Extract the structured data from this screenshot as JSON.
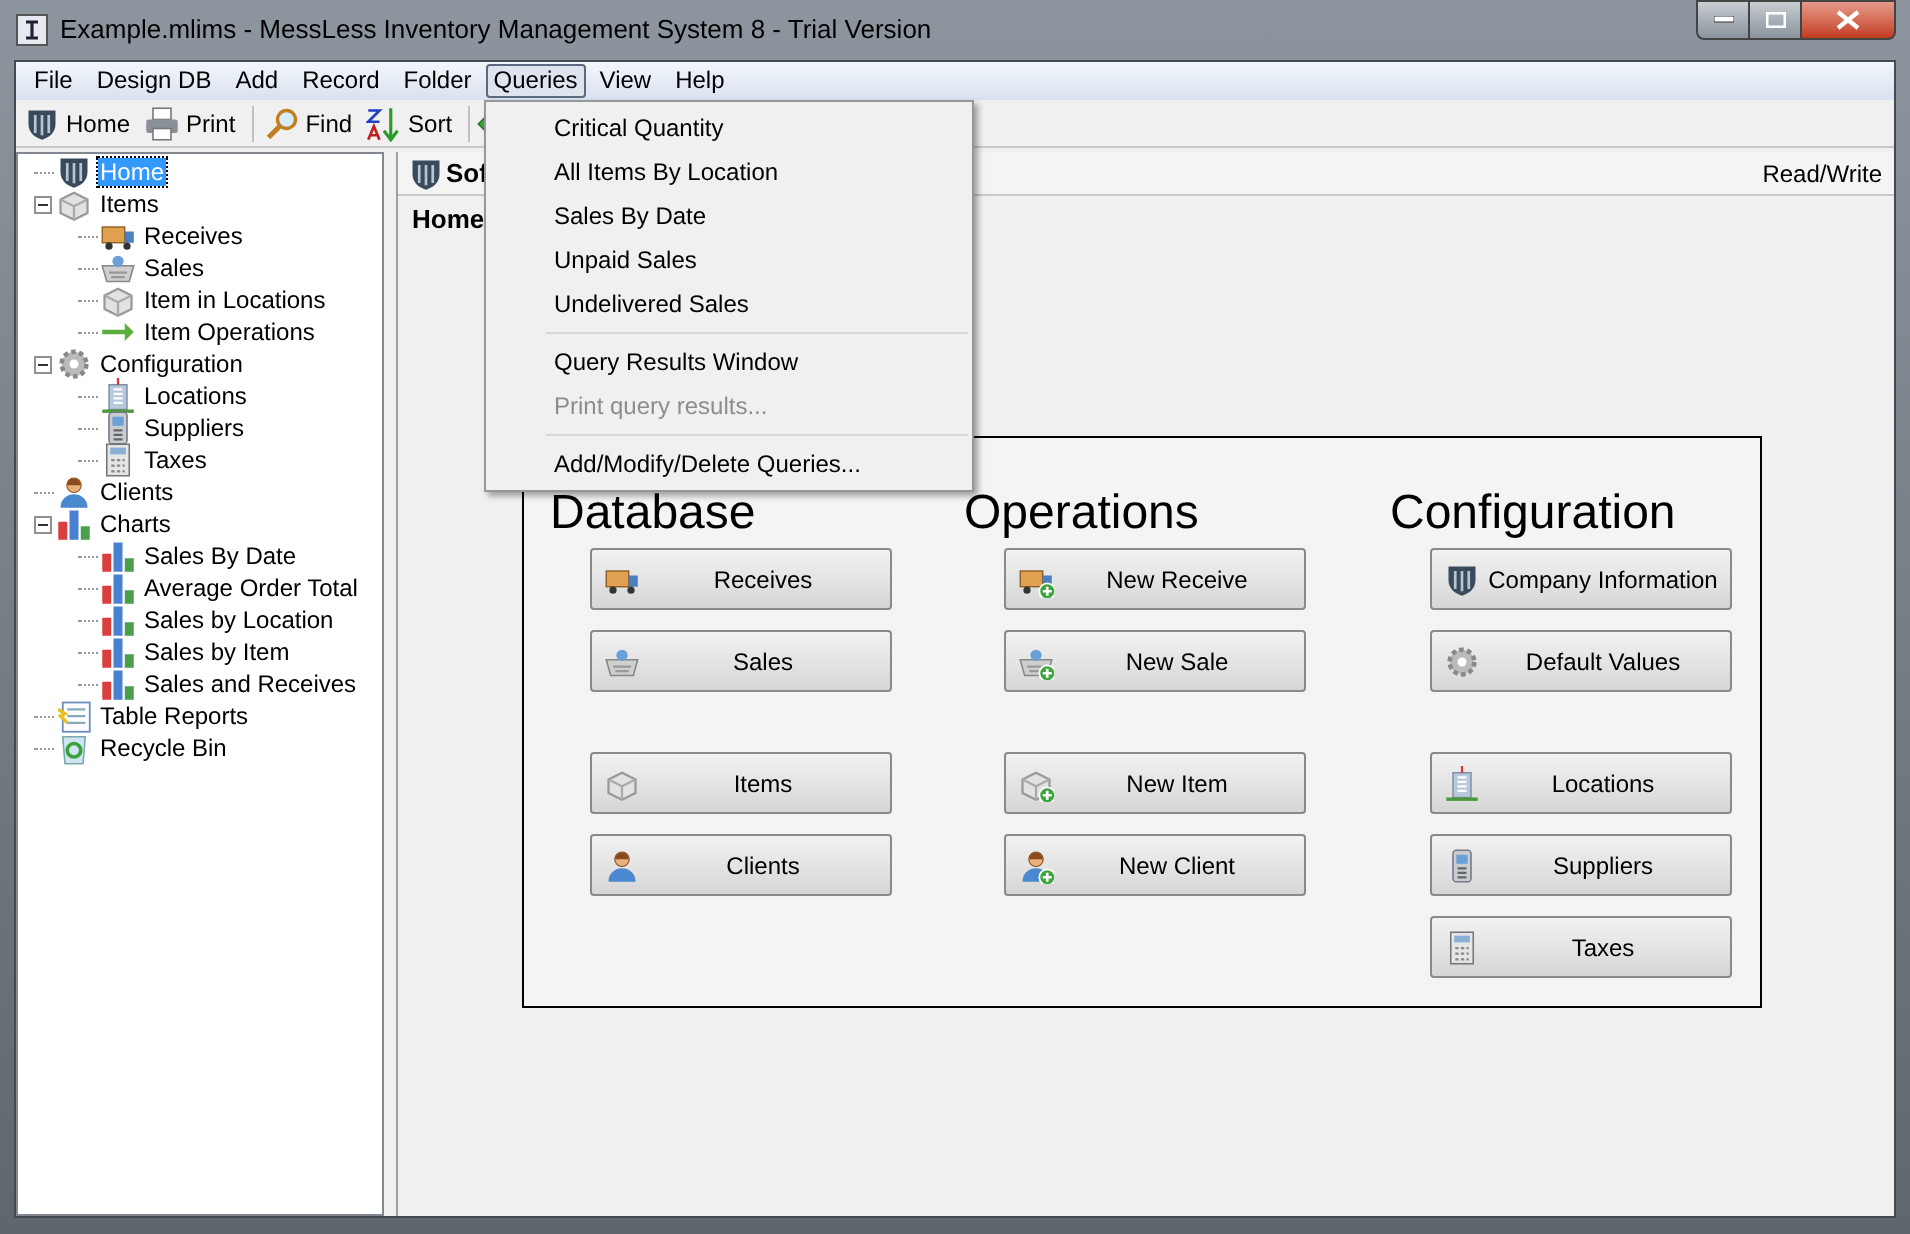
{
  "window": {
    "title": "Example.mlims - MessLess Inventory Management System 8 - Trial Version"
  },
  "menu_bar": [
    {
      "label": "File",
      "selected": false
    },
    {
      "label": "Design DB",
      "selected": false
    },
    {
      "label": "Add",
      "selected": false
    },
    {
      "label": "Record",
      "selected": false
    },
    {
      "label": "Folder",
      "selected": false
    },
    {
      "label": "Queries",
      "selected": true
    },
    {
      "label": "View",
      "selected": false
    },
    {
      "label": "Help",
      "selected": false
    }
  ],
  "toolbar": [
    {
      "label": "Home",
      "kind": "shield"
    },
    {
      "label": "Print",
      "kind": "printer"
    },
    {
      "label": "Find",
      "kind": "search"
    },
    {
      "label": "Sort",
      "kind": "sort"
    },
    {
      "kind": "back"
    }
  ],
  "tree": [
    {
      "label": "Home",
      "kind": "shield",
      "selected": true
    },
    {
      "label": "Items",
      "kind": "box",
      "selected": false,
      "expanded": true,
      "children": [
        {
          "label": "Receives",
          "kind": "truck",
          "selected": false
        },
        {
          "label": "Sales",
          "kind": "basket",
          "selected": false
        },
        {
          "label": "Item in Locations",
          "kind": "box",
          "selected": false
        },
        {
          "label": "Item Operations",
          "kind": "arrow",
          "selected": false
        }
      ]
    },
    {
      "label": "Configuration",
      "kind": "gear",
      "selected": false,
      "expanded": true,
      "children": [
        {
          "label": "Locations",
          "kind": "building",
          "selected": false
        },
        {
          "label": "Suppliers",
          "kind": "phone",
          "selected": false
        },
        {
          "label": "Taxes",
          "kind": "calculator",
          "selected": false
        }
      ]
    },
    {
      "label": "Clients",
      "kind": "person",
      "selected": false
    },
    {
      "label": "Charts",
      "kind": "chart",
      "selected": false,
      "expanded": true,
      "children": [
        {
          "label": "Sales By Date",
          "kind": "chart",
          "selected": false
        },
        {
          "label": "Average Order Total",
          "kind": "chart",
          "selected": false
        },
        {
          "label": "Sales by Location",
          "kind": "chart",
          "selected": false
        },
        {
          "label": "Sales by Item",
          "kind": "chart",
          "selected": false
        },
        {
          "label": "Sales and Receives",
          "kind": "chart",
          "selected": false
        }
      ]
    },
    {
      "label": "Table Reports",
      "kind": "report",
      "selected": false
    },
    {
      "label": "Recycle Bin",
      "kind": "bin",
      "selected": false
    }
  ],
  "panel": {
    "title": "Sof",
    "access": "Read/Write",
    "breadcrumb": "Home",
    "sections": [
      {
        "heading": "Database",
        "groups": [
          [
            {
              "label": "Receives",
              "kind": "truck"
            },
            {
              "label": "Sales",
              "kind": "basket"
            }
          ],
          [
            {
              "label": "Items",
              "kind": "box"
            },
            {
              "label": "Clients",
              "kind": "person"
            }
          ]
        ]
      },
      {
        "heading": "Operations",
        "groups": [
          [
            {
              "label": "New Receive",
              "kind": "truck-add"
            },
            {
              "label": "New Sale",
              "kind": "basket-add"
            }
          ],
          [
            {
              "label": "New Item",
              "kind": "box-add"
            },
            {
              "label": "New Client",
              "kind": "person-add"
            }
          ]
        ]
      },
      {
        "heading": "Configuration",
        "groups": [
          [
            {
              "label": "Company Information",
              "kind": "shield"
            },
            {
              "label": "Default Values",
              "kind": "gear"
            }
          ],
          [
            {
              "label": "Locations",
              "kind": "building"
            },
            {
              "label": "Suppliers",
              "kind": "phone"
            },
            {
              "label": "Taxes",
              "kind": "calculator"
            }
          ]
        ]
      }
    ]
  },
  "queries_menu": {
    "groups": [
      [
        {
          "label": "Critical Quantity",
          "disabled": false
        },
        {
          "label": "All Items By Location",
          "disabled": false
        },
        {
          "label": "Sales By Date",
          "disabled": false
        },
        {
          "label": "Unpaid Sales",
          "disabled": false
        },
        {
          "label": "Undelivered Sales",
          "disabled": false
        }
      ],
      [
        {
          "label": "Query Results Window",
          "disabled": false
        },
        {
          "label": "Print query results...",
          "disabled": true
        }
      ],
      [
        {
          "label": "Add/Modify/Delete Queries...",
          "disabled": false
        }
      ]
    ]
  }
}
